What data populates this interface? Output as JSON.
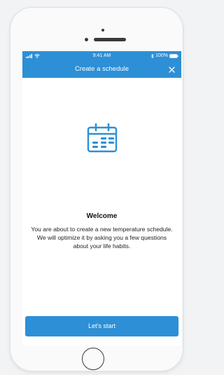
{
  "status_bar": {
    "time": "9:41 AM",
    "battery": "100%"
  },
  "header": {
    "title": "Create a schedule",
    "close_label": "✕"
  },
  "main": {
    "heading": "Welcome",
    "description": "You are about to create a new temperature schedule. We will optimize it by asking you a few questions about your life habits.",
    "button_label": "Let's start"
  },
  "colors": {
    "accent": "#2d8fd6"
  }
}
